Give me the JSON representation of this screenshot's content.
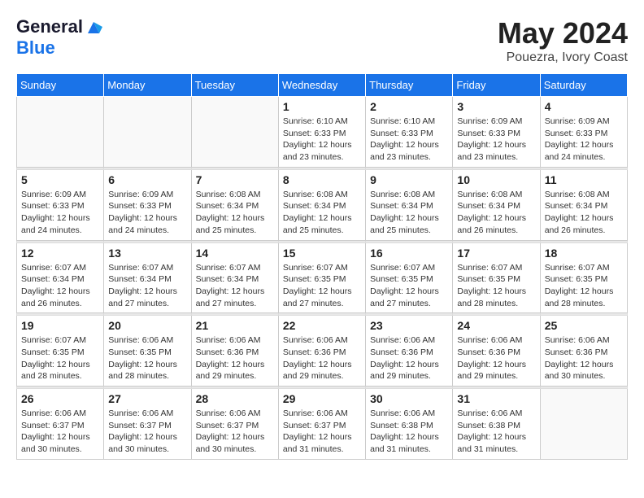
{
  "header": {
    "logo_line1": "General",
    "logo_line2": "Blue",
    "month_year": "May 2024",
    "location": "Pouezra, Ivory Coast"
  },
  "weekdays": [
    "Sunday",
    "Monday",
    "Tuesday",
    "Wednesday",
    "Thursday",
    "Friday",
    "Saturday"
  ],
  "weeks": [
    [
      {
        "day": "",
        "info": ""
      },
      {
        "day": "",
        "info": ""
      },
      {
        "day": "",
        "info": ""
      },
      {
        "day": "1",
        "info": "Sunrise: 6:10 AM\nSunset: 6:33 PM\nDaylight: 12 hours\nand 23 minutes."
      },
      {
        "day": "2",
        "info": "Sunrise: 6:10 AM\nSunset: 6:33 PM\nDaylight: 12 hours\nand 23 minutes."
      },
      {
        "day": "3",
        "info": "Sunrise: 6:09 AM\nSunset: 6:33 PM\nDaylight: 12 hours\nand 23 minutes."
      },
      {
        "day": "4",
        "info": "Sunrise: 6:09 AM\nSunset: 6:33 PM\nDaylight: 12 hours\nand 24 minutes."
      }
    ],
    [
      {
        "day": "5",
        "info": "Sunrise: 6:09 AM\nSunset: 6:33 PM\nDaylight: 12 hours\nand 24 minutes."
      },
      {
        "day": "6",
        "info": "Sunrise: 6:09 AM\nSunset: 6:33 PM\nDaylight: 12 hours\nand 24 minutes."
      },
      {
        "day": "7",
        "info": "Sunrise: 6:08 AM\nSunset: 6:34 PM\nDaylight: 12 hours\nand 25 minutes."
      },
      {
        "day": "8",
        "info": "Sunrise: 6:08 AM\nSunset: 6:34 PM\nDaylight: 12 hours\nand 25 minutes."
      },
      {
        "day": "9",
        "info": "Sunrise: 6:08 AM\nSunset: 6:34 PM\nDaylight: 12 hours\nand 25 minutes."
      },
      {
        "day": "10",
        "info": "Sunrise: 6:08 AM\nSunset: 6:34 PM\nDaylight: 12 hours\nand 26 minutes."
      },
      {
        "day": "11",
        "info": "Sunrise: 6:08 AM\nSunset: 6:34 PM\nDaylight: 12 hours\nand 26 minutes."
      }
    ],
    [
      {
        "day": "12",
        "info": "Sunrise: 6:07 AM\nSunset: 6:34 PM\nDaylight: 12 hours\nand 26 minutes."
      },
      {
        "day": "13",
        "info": "Sunrise: 6:07 AM\nSunset: 6:34 PM\nDaylight: 12 hours\nand 27 minutes."
      },
      {
        "day": "14",
        "info": "Sunrise: 6:07 AM\nSunset: 6:34 PM\nDaylight: 12 hours\nand 27 minutes."
      },
      {
        "day": "15",
        "info": "Sunrise: 6:07 AM\nSunset: 6:35 PM\nDaylight: 12 hours\nand 27 minutes."
      },
      {
        "day": "16",
        "info": "Sunrise: 6:07 AM\nSunset: 6:35 PM\nDaylight: 12 hours\nand 27 minutes."
      },
      {
        "day": "17",
        "info": "Sunrise: 6:07 AM\nSunset: 6:35 PM\nDaylight: 12 hours\nand 28 minutes."
      },
      {
        "day": "18",
        "info": "Sunrise: 6:07 AM\nSunset: 6:35 PM\nDaylight: 12 hours\nand 28 minutes."
      }
    ],
    [
      {
        "day": "19",
        "info": "Sunrise: 6:07 AM\nSunset: 6:35 PM\nDaylight: 12 hours\nand 28 minutes."
      },
      {
        "day": "20",
        "info": "Sunrise: 6:06 AM\nSunset: 6:35 PM\nDaylight: 12 hours\nand 28 minutes."
      },
      {
        "day": "21",
        "info": "Sunrise: 6:06 AM\nSunset: 6:36 PM\nDaylight: 12 hours\nand 29 minutes."
      },
      {
        "day": "22",
        "info": "Sunrise: 6:06 AM\nSunset: 6:36 PM\nDaylight: 12 hours\nand 29 minutes."
      },
      {
        "day": "23",
        "info": "Sunrise: 6:06 AM\nSunset: 6:36 PM\nDaylight: 12 hours\nand 29 minutes."
      },
      {
        "day": "24",
        "info": "Sunrise: 6:06 AM\nSunset: 6:36 PM\nDaylight: 12 hours\nand 29 minutes."
      },
      {
        "day": "25",
        "info": "Sunrise: 6:06 AM\nSunset: 6:36 PM\nDaylight: 12 hours\nand 30 minutes."
      }
    ],
    [
      {
        "day": "26",
        "info": "Sunrise: 6:06 AM\nSunset: 6:37 PM\nDaylight: 12 hours\nand 30 minutes."
      },
      {
        "day": "27",
        "info": "Sunrise: 6:06 AM\nSunset: 6:37 PM\nDaylight: 12 hours\nand 30 minutes."
      },
      {
        "day": "28",
        "info": "Sunrise: 6:06 AM\nSunset: 6:37 PM\nDaylight: 12 hours\nand 30 minutes."
      },
      {
        "day": "29",
        "info": "Sunrise: 6:06 AM\nSunset: 6:37 PM\nDaylight: 12 hours\nand 31 minutes."
      },
      {
        "day": "30",
        "info": "Sunrise: 6:06 AM\nSunset: 6:38 PM\nDaylight: 12 hours\nand 31 minutes."
      },
      {
        "day": "31",
        "info": "Sunrise: 6:06 AM\nSunset: 6:38 PM\nDaylight: 12 hours\nand 31 minutes."
      },
      {
        "day": "",
        "info": ""
      }
    ]
  ]
}
